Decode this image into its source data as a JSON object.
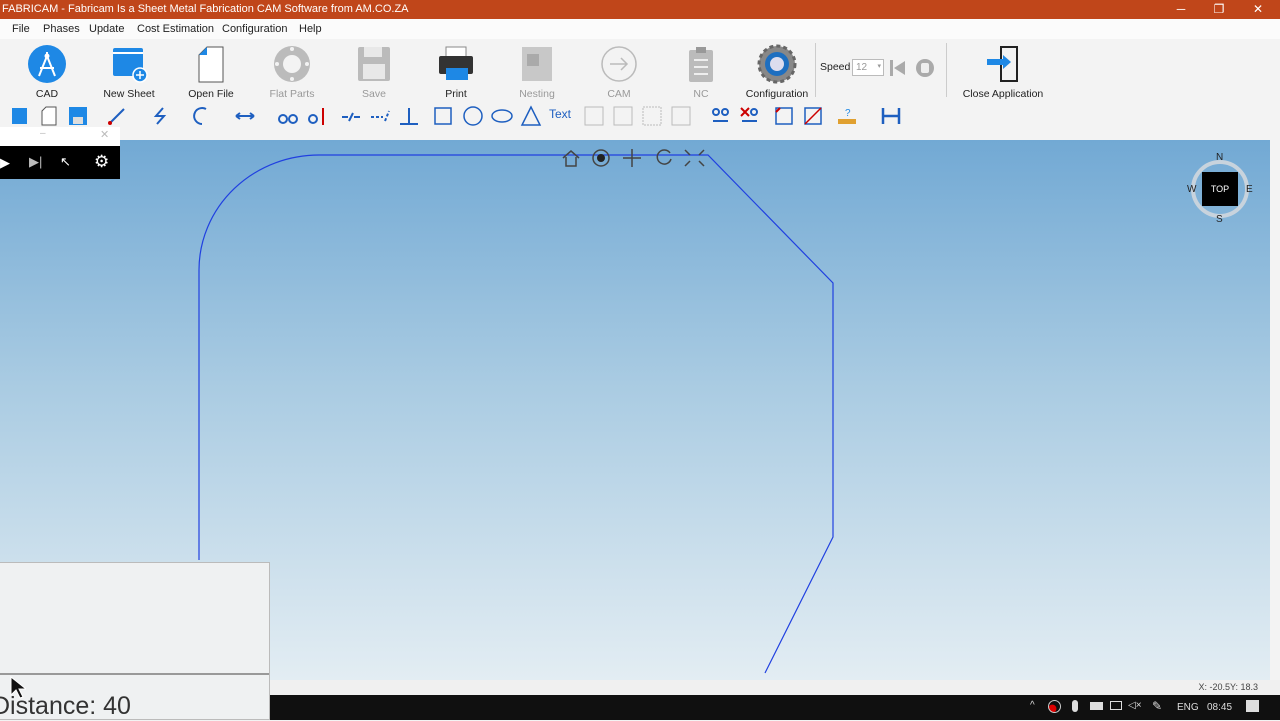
{
  "window": {
    "title": "FABRICAM - Fabricam Is a Sheet Metal Fabrication CAM Software from AM.CO.ZA",
    "minimize": "─",
    "maximize": "❐",
    "close": "✕"
  },
  "menu": [
    "File",
    "Phases",
    "Update",
    "Cost Estimation",
    "Configuration",
    "Help"
  ],
  "ribbon": {
    "buttons": [
      {
        "label": "CAD",
        "icon": "compass-icon",
        "enabled": true
      },
      {
        "label": "New Sheet",
        "icon": "new-sheet-icon",
        "enabled": true
      },
      {
        "label": "Open File",
        "icon": "open-file-icon",
        "enabled": true
      },
      {
        "label": "Flat Parts",
        "icon": "flat-parts-icon",
        "enabled": false
      },
      {
        "label": "Save",
        "icon": "save-icon",
        "enabled": false
      },
      {
        "label": "Print",
        "icon": "printer-icon",
        "enabled": true
      },
      {
        "label": "Nesting",
        "icon": "nesting-icon",
        "enabled": false
      },
      {
        "label": "CAM",
        "icon": "arrow-circle-icon",
        "enabled": false
      },
      {
        "label": "NC",
        "icon": "clipboard-icon",
        "enabled": false
      },
      {
        "label": "Configuration",
        "icon": "gear-icon",
        "enabled": true
      }
    ],
    "speed_label": "Speed",
    "speed_value": "12",
    "close_app": "Close Application"
  },
  "toolbar": {
    "text_tool": "Text"
  },
  "view": {
    "compass": {
      "center": "TOP",
      "n": "N",
      "s": "S",
      "e": "E",
      "w": "W"
    }
  },
  "status": {
    "coords": "X: -20.5Y: 18.3"
  },
  "overlay": {
    "distance": "Distance: 40"
  },
  "taskbar": {
    "lang": "ENG",
    "time": "08:45"
  },
  "colors": {
    "title": "#c0461a",
    "accent": "#1e88e5",
    "shape": "#2040e0"
  }
}
